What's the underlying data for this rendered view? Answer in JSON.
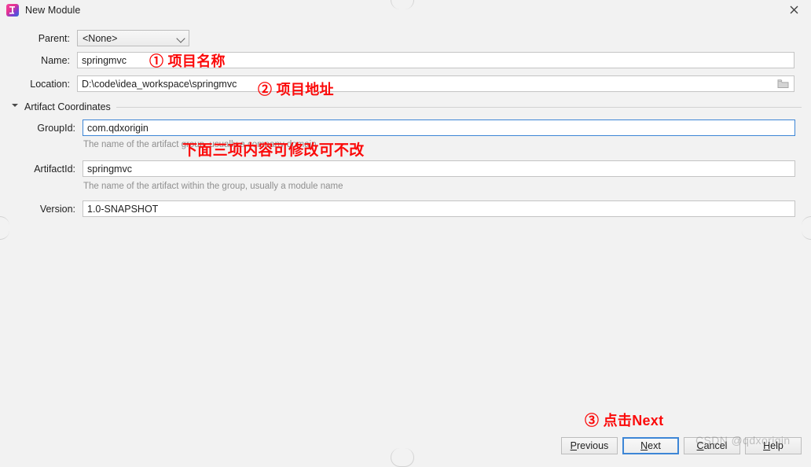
{
  "window": {
    "title": "New Module",
    "app_icon": "intellij-idea-icon",
    "close_icon": "close-icon"
  },
  "form": {
    "parent": {
      "label": "Parent:",
      "value": "<None>",
      "chevron_icon": "chevron-down-icon"
    },
    "name": {
      "label": "Name:",
      "value": "springmvc",
      "placeholder": ""
    },
    "location": {
      "label": "Location:",
      "value": "D:\\code\\idea_workspace\\springmvc",
      "placeholder": "",
      "browse_icon": "folder-icon"
    }
  },
  "artifact_section": {
    "title": "Artifact Coordinates",
    "expanded_icon": "triangle-down-icon",
    "group_id": {
      "label": "GroupId:",
      "value": "com.qdxorigin",
      "help": "The name of the artifact group, usually a company domain"
    },
    "artifact_id": {
      "label": "ArtifactId:",
      "value": "springmvc",
      "help": "The name of the artifact within the group, usually a module name"
    },
    "version": {
      "label": "Version:",
      "value": "1.0-SNAPSHOT"
    }
  },
  "buttons": {
    "previous": {
      "prefix": "",
      "mnemonic": "P",
      "suffix": "revious"
    },
    "next": {
      "prefix": "",
      "mnemonic": "N",
      "suffix": "ext"
    },
    "cancel": {
      "prefix": "",
      "mnemonic": "C",
      "suffix": "ancel"
    },
    "help": {
      "prefix": "",
      "mnemonic": "H",
      "suffix": "elp"
    }
  },
  "annotations": [
    {
      "id": 1,
      "text": "① 项目名称"
    },
    {
      "id": 2,
      "text": "② 项目地址"
    },
    {
      "id": 3,
      "text": "下面三项内容可修改可不改"
    },
    {
      "id": 4,
      "text": "③ 点击Next"
    }
  ],
  "watermark": "CSDN @qdxorigin",
  "colors": {
    "dialog_background": "#f2f2f2",
    "focus_blue": "#3d86d6",
    "annotation_red": "#fb0a0a",
    "help_gray": "#8f8f8f"
  }
}
